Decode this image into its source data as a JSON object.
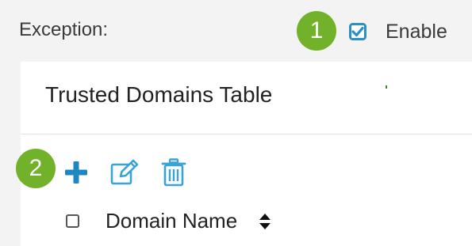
{
  "exception": {
    "label": "Exception:",
    "enable_label": "Enable",
    "enable_checked": true
  },
  "badges": {
    "step1": "1",
    "step2": "2"
  },
  "table": {
    "title": "Trusted Domains Table",
    "columns": [
      "Domain Name"
    ]
  },
  "toolbar": {
    "icons": [
      "plus-icon",
      "edit-icon",
      "trash-icon"
    ]
  },
  "colors": {
    "badge": "#72b22b",
    "accent": "#2a8fc4",
    "text": "#222222"
  }
}
